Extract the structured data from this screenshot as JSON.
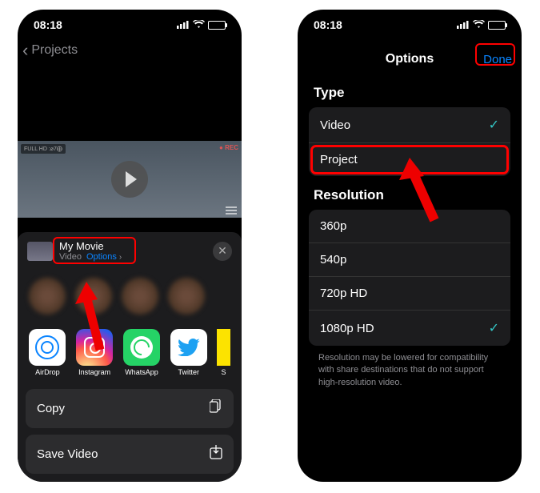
{
  "status": {
    "time": "08:18"
  },
  "left": {
    "back": "Projects",
    "rec_badge": "FULL HD :⌀7⨁",
    "rec_label": "REC",
    "share": {
      "title": "My Movie",
      "subtitle_type": "Video",
      "options_label": "Options"
    },
    "apps": {
      "airdrop": "AirDrop",
      "instagram": "Instagram",
      "whatsapp": "WhatsApp",
      "twitter": "Twitter",
      "more": "S"
    },
    "actions": {
      "copy": "Copy",
      "save": "Save Video"
    }
  },
  "right": {
    "header_title": "Options",
    "done": "Done",
    "section_type": "Type",
    "type_video": "Video",
    "type_project": "Project",
    "section_resolution": "Resolution",
    "res_360": "360p",
    "res_540": "540p",
    "res_720": "720p HD",
    "res_1080": "1080p HD",
    "note": "Resolution may be lowered for compatibility with share destinations that do not support high-resolution video."
  }
}
